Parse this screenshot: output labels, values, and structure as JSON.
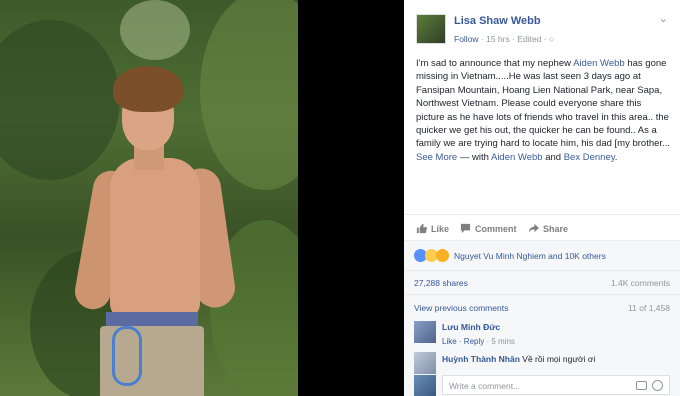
{
  "post": {
    "author": "Lisa Shaw Webb",
    "follow": "Follow",
    "time": " · 15 hrs · Edited · ",
    "text_intro": "I'm sad to announce that my nephew ",
    "mention1": "Aiden Webb",
    "text_body": " has gone missing in Vietnam.....He was last seen 3 days ago at Fansipan Mountain, Hoang Lien National Park, near Sapa, Northwest Vietnam. Please could everyone share this picture as he have lots of friends who travel in this area.. the quicker we get his out, the quicker he can be found.. As a family we are trying hard to locate him, his dad [my brother... ",
    "see_more": "See More",
    "with_text": " — with ",
    "mention2": "Aiden Webb",
    "and_text": " and ",
    "mention3": "Bex Denney",
    "period": "."
  },
  "actions": {
    "like": "Like",
    "comment": "Comment",
    "share": "Share"
  },
  "reactions": {
    "text": "Nguyet Vu Minh Nghiem and 10K others"
  },
  "stats": {
    "shares": "27,288 shares",
    "comments": "1.4K comments"
  },
  "comments": {
    "view_previous": "View previous comments",
    "count": "11 of 1,458",
    "items": [
      {
        "name": "Lưu Minh Đức",
        "text": ""
      },
      {
        "name": "Huỳnh Thành Nhân",
        "text": " Về rồi mọi người ơi"
      }
    ],
    "like_label": "Like",
    "reply_label": "Reply",
    "time": " · 5 mins",
    "write_placeholder": "Write a comment..."
  },
  "icons": {
    "menu": "chevron-down-icon",
    "like": "thumbs-up-icon",
    "comment": "speech-bubble-icon",
    "share": "share-arrow-icon",
    "camera": "camera-icon",
    "emoji": "emoji-icon"
  },
  "colors": {
    "link": "#3b5998",
    "muted": "#90949c",
    "panel_bg": "#f6f7f9"
  }
}
